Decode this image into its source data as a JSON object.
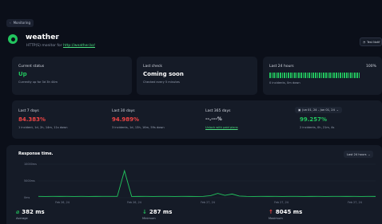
{
  "breadcrumb": {
    "label": "Monitoring"
  },
  "monitor": {
    "name": "weather",
    "subtitle_prefix": "HTTP(S) monitor for ",
    "url": "http://weather.bz/"
  },
  "test_button": {
    "label": "Test Notif"
  },
  "current_status": {
    "label": "Current status",
    "value": "Up",
    "note": "Currently up for 3d 3h 44m"
  },
  "last_check": {
    "label": "Last check",
    "value": "Coming soon",
    "note": "Checked every 5 minutes"
  },
  "last_24h": {
    "label": "Last 24 hours",
    "percent": "100%",
    "bars": 44,
    "note": "0 incidents, 0m down"
  },
  "last_7d": {
    "label": "Last 7 days",
    "value": "84.383%",
    "note": "1 incident, 1d, 2h, 14m, 11s down"
  },
  "last_30d": {
    "label": "Last 30 days",
    "value": "94.989%",
    "note": "3 incidents, 1d, 13h, 16m, 59s down"
  },
  "last_365d": {
    "label": "Last 365 days",
    "value": "--.---%",
    "link": "Unlock with paid plans"
  },
  "custom_range": {
    "label": "Jun 01, 24 – Jun 01, 24",
    "value": "99.257%",
    "note": "2 incidents, 0h, 21m, 4s"
  },
  "colors": {
    "up": "#22c55e",
    "down": "#ef4444",
    "card": "#151b27",
    "background": "#0b0f19"
  },
  "response_chart": {
    "title": "Response time.",
    "range_label": "Last 24 hours",
    "y_ticks": [
      "10000ms",
      "5000ms",
      "0ms"
    ],
    "x_ticks": [
      "Feb 26, 24",
      "Feb 26, 24",
      "Feb 27, 24",
      "Feb 27, 24",
      "Feb 27, 24"
    ]
  },
  "chart_data": {
    "type": "line",
    "title": "Response time.",
    "xlabel": "",
    "ylabel": "",
    "ylim": [
      0,
      10000
    ],
    "series": [
      {
        "values": [
          390,
          380,
          400,
          385,
          395,
          380,
          390,
          380,
          385,
          395,
          390,
          400,
          8045,
          380,
          385,
          390,
          380,
          390,
          395,
          380,
          390,
          385,
          380,
          390,
          600,
          1300,
          700,
          1100,
          500,
          390,
          380,
          390,
          385,
          390,
          380,
          395,
          390,
          380,
          385,
          390,
          380,
          395,
          390,
          385,
          390,
          380,
          390,
          385
        ]
      }
    ]
  },
  "stats": {
    "average": {
      "value": "382 ms",
      "label": "Average"
    },
    "minimum": {
      "value": "287 ms",
      "label": "Minimum"
    },
    "maximum": {
      "value": "8045 ms",
      "label": "Maximum"
    }
  }
}
